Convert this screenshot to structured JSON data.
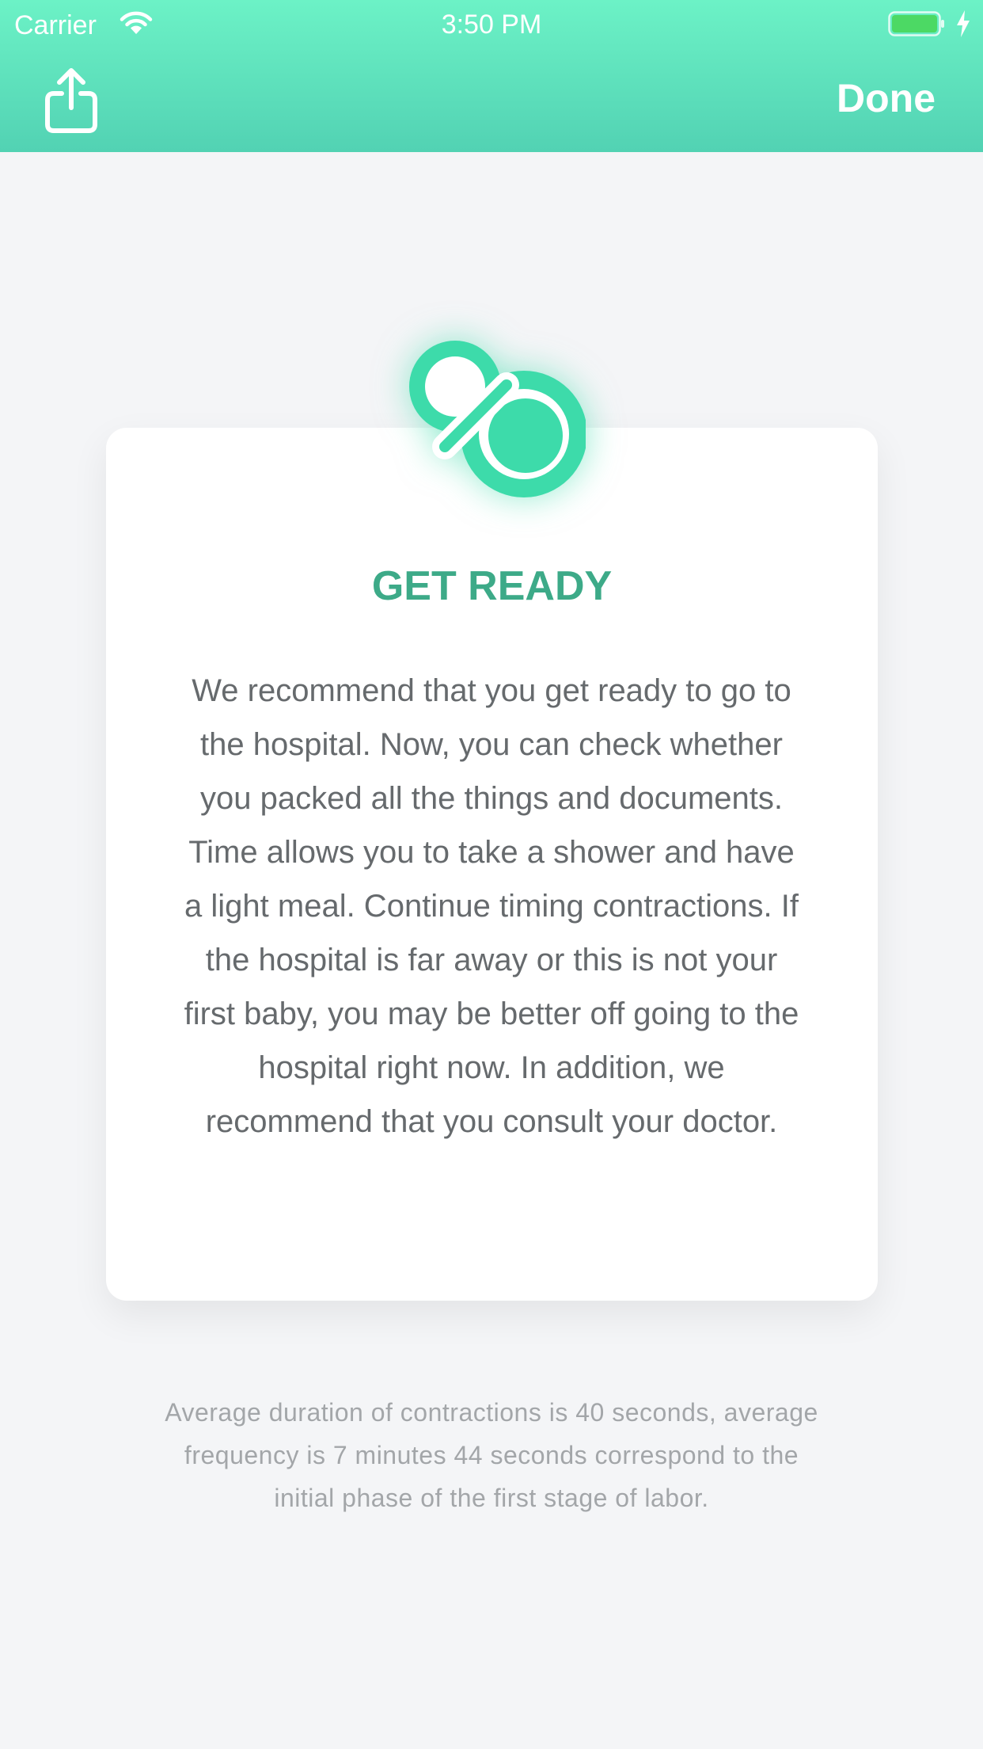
{
  "status_bar": {
    "carrier": "Carrier",
    "time": "3:50 PM",
    "wifi_icon": "wifi-icon",
    "battery_icon": "battery-full-icon",
    "charging_icon": "charging-bolt-icon"
  },
  "nav": {
    "share_icon": "share-icon",
    "done_label": "Done"
  },
  "card": {
    "icon": "pacifier-icon",
    "title": "GET READY",
    "body": "We recommend that you get ready to go to the hospital. Now, you can check whether you packed all the things and documents. Time allows you to take a shower and have a light meal. Continue timing contractions. If the hospital is far away or this is not your first baby, you may be better off going to the hospital right now. In addition, we recommend that you consult your doctor."
  },
  "footer": {
    "summary": "Average duration of contractions is 40 seconds, average frequency is 7 minutes 44 seconds correspond to the initial phase of the first stage of labor."
  },
  "colors": {
    "header_top": "#6cf2c6",
    "header_bottom": "#52d2b3",
    "accent": "#3ddbaa",
    "title": "#3daa88",
    "background": "#f4f5f7"
  }
}
